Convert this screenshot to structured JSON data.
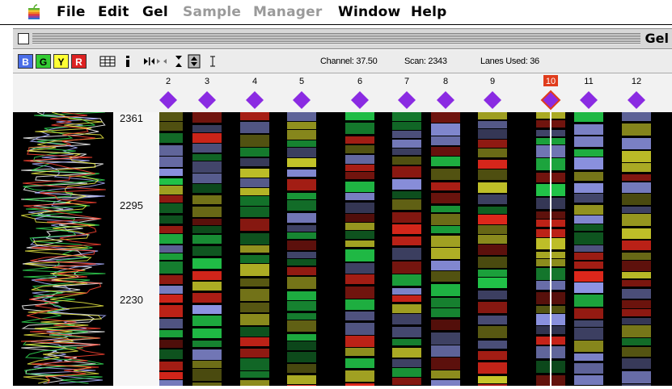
{
  "menubar": {
    "items": [
      {
        "label": "File",
        "enabled": true
      },
      {
        "label": "Edit",
        "enabled": true
      },
      {
        "label": "Gel",
        "enabled": true
      },
      {
        "label": "Sample",
        "enabled": false
      },
      {
        "label": "Manager",
        "enabled": false
      },
      {
        "label": "Window",
        "enabled": true
      },
      {
        "label": "Help",
        "enabled": true
      }
    ],
    "apple_icon": "apple-rainbow-icon"
  },
  "window": {
    "title": "Gel"
  },
  "toolbar": {
    "color_buttons": [
      {
        "label": "B",
        "color": "#4a6ee8"
      },
      {
        "label": "G",
        "color": "#33cc33"
      },
      {
        "label": "Y",
        "color": "#ffff33"
      },
      {
        "label": "R",
        "color": "#dd2222"
      }
    ],
    "icons": [
      "grid-icon",
      "info-icon",
      "expand-horizontal-icon",
      "expand-vertical-icon",
      "stepper-icon",
      "text-cursor-icon"
    ],
    "channel": "Channel: 37.50",
    "scan": "Scan: 2343",
    "lanes_used": "Lanes Used: 36"
  },
  "lanes": {
    "numbers": [
      "2",
      "3",
      "4",
      "5",
      "6",
      "7",
      "8",
      "9",
      "10",
      "11",
      "12"
    ],
    "selected": "10",
    "marker_color": "#8a2be2",
    "selected_color": "#e03c1c"
  },
  "scan_axis": {
    "labels": [
      "2361",
      "2295",
      "2230"
    ]
  },
  "colors": {
    "blue": "#8f96e6",
    "green": "#22c84a",
    "yellow": "#c8c82a",
    "red": "#e0281c"
  }
}
